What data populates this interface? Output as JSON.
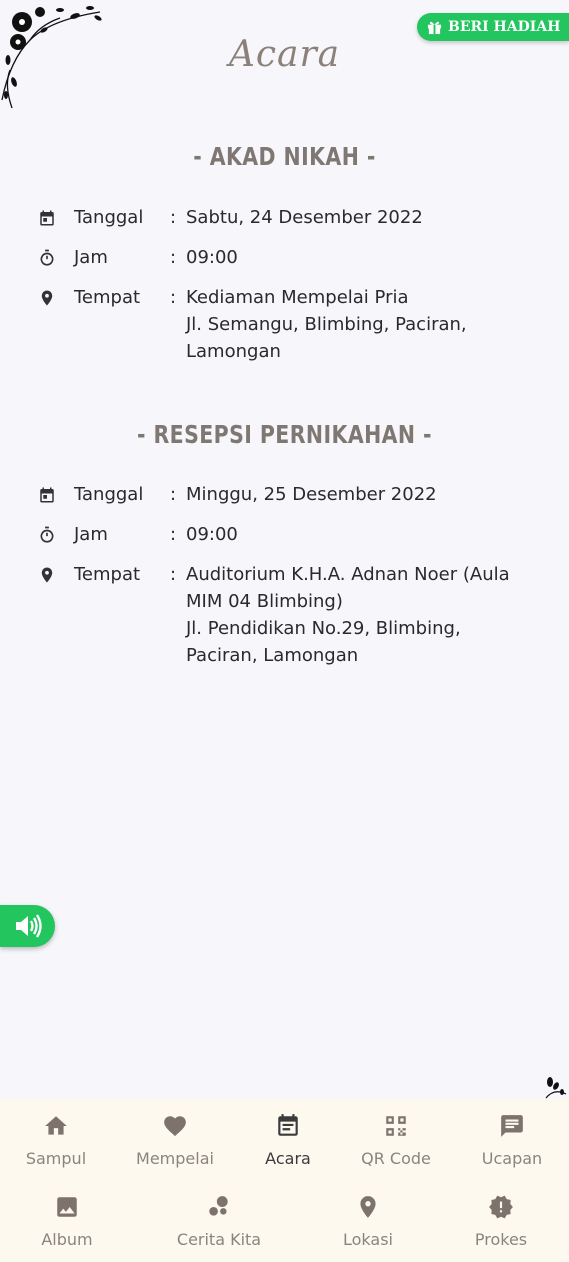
{
  "gift_button": {
    "label": "BERI HADIAH"
  },
  "page_title": "Acara",
  "akad": {
    "title": "- AKAD NIKAH -",
    "tanggal_label": "Tanggal",
    "tanggal_value": "Sabtu, 24 Desember 2022",
    "jam_label": "Jam",
    "jam_value": "09:00",
    "tempat_label": "Tempat",
    "tempat_lines": [
      "Kediaman Mempelai Pria",
      "Jl. Semangu, Blimbing, Paciran,",
      "Lamongan"
    ]
  },
  "resepsi": {
    "title": "- RESEPSI PERNIKAHAN -",
    "tanggal_label": "Tanggal",
    "tanggal_value": "Minggu, 25 Desember 2022",
    "jam_label": "Jam",
    "jam_value": "09:00",
    "tempat_label": "Tempat",
    "tempat_lines": [
      "Auditorium K.H.A. Adnan Noer (Aula",
      "MIM 04 Blimbing)",
      "Jl. Pendidikan No.29, Blimbing,",
      "Paciran, Lamongan"
    ]
  },
  "colon": ":",
  "nav": {
    "items": [
      {
        "label": "Sampul",
        "icon": "home-icon"
      },
      {
        "label": "Mempelai",
        "icon": "heart-icon"
      },
      {
        "label": "Acara",
        "icon": "calendar-icon",
        "active": true
      },
      {
        "label": "QR Code",
        "icon": "qr-code-icon"
      },
      {
        "label": "Ucapan",
        "icon": "message-icon"
      },
      {
        "label": "Album",
        "icon": "image-icon"
      },
      {
        "label": "Cerita Kita",
        "icon": "bubbles-icon"
      },
      {
        "label": "Lokasi",
        "icon": "map-pin-icon"
      },
      {
        "label": "Prokes",
        "icon": "badge-alert-icon"
      }
    ]
  },
  "colors": {
    "accent": "#22c55e",
    "title": "#8c8178",
    "nav_bg": "#fdf9ef"
  }
}
